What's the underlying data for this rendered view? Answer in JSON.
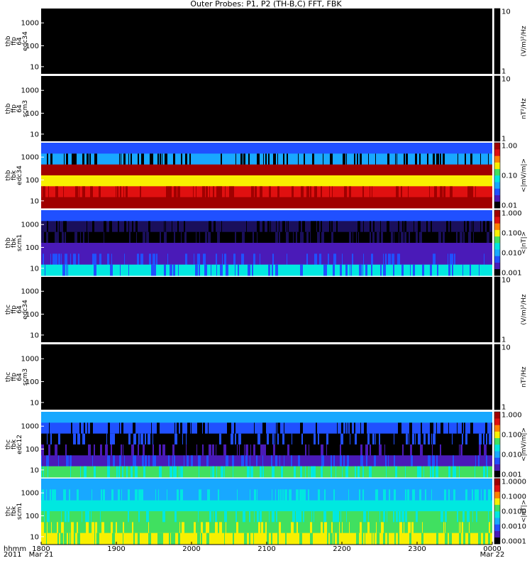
{
  "title": "Outer Probes: P1, P2 (TH-B,C) FFT, FBK",
  "colors": {
    "black": "#000000",
    "navy": "#1a0f5c",
    "purple": "#4a1ab8",
    "blue": "#2050ff",
    "lightblue": "#18a8ff",
    "cyan": "#00e8e0",
    "green": "#40e060",
    "yellow": "#f8f000",
    "orange": "#ff8000",
    "red": "#e01010",
    "darkred": "#a00000"
  },
  "chart_data": [
    {
      "type": "heatmap",
      "panel": "thb-ffp64-edc34",
      "ylabel": [
        "thb",
        "ffp",
        "64",
        "edc34"
      ],
      "yticks": [
        "1000",
        "100",
        "10"
      ],
      "cbar_label": "(V/m)²/Hz",
      "cbar_ticks": [
        "10",
        "1"
      ],
      "bands": []
    },
    {
      "type": "heatmap",
      "panel": "thb-ffp64-scm3",
      "ylabel": [
        "thb",
        "ffp",
        "64",
        "scm3"
      ],
      "yticks": [
        "1000",
        "100",
        "10"
      ],
      "cbar_label": "nT²/Hz",
      "cbar_ticks": [
        "10",
        "1"
      ],
      "bands": []
    },
    {
      "type": "heatmap",
      "panel": "thb-fbk-edc34",
      "ylabel": [
        "thb",
        "fbk",
        "edc34"
      ],
      "yticks": [
        "1000",
        "100",
        "10"
      ],
      "cbar_label": "<|mV/m|>",
      "cbar_ticks": [
        "1.00",
        "0.10",
        "0.01"
      ],
      "bands": [
        [
          "blue",
          "none"
        ],
        [
          "lightblue",
          "black"
        ],
        [
          "darkred",
          "none"
        ],
        [
          "yellow",
          "none"
        ],
        [
          "red",
          "darkred"
        ],
        [
          "darkred",
          "none"
        ]
      ]
    },
    {
      "type": "heatmap",
      "panel": "thb-fbk-scm1",
      "ylabel": [
        "thb",
        "fbk",
        "scm1"
      ],
      "yticks": [
        "1000",
        "100",
        "10"
      ],
      "cbar_label": "<|nT|>",
      "cbar_ticks": [
        "1.000",
        "0.100",
        "0.010",
        "0.001"
      ],
      "bands": [
        [
          "blue",
          "none"
        ],
        [
          "navy",
          "black"
        ],
        [
          "black",
          "navy"
        ],
        [
          "purple",
          "none"
        ],
        [
          "purple",
          "blue"
        ],
        [
          "cyan",
          "blue"
        ]
      ]
    },
    {
      "type": "heatmap",
      "panel": "thc-ffp64-edc34",
      "ylabel": [
        "thc",
        "ffp",
        "64",
        "edc34"
      ],
      "yticks": [
        "1000",
        "100",
        "10"
      ],
      "cbar_label": "(V/m)²/Hz",
      "cbar_ticks": [
        "10",
        "1"
      ],
      "bands": []
    },
    {
      "type": "heatmap",
      "panel": "thc-ffp64-scm3",
      "ylabel": [
        "thc",
        "ffp",
        "64",
        "scm3"
      ],
      "yticks": [
        "1000",
        "100",
        "10"
      ],
      "cbar_label": "nT²/Hz",
      "cbar_ticks": [
        "10",
        "1"
      ],
      "bands": []
    },
    {
      "type": "heatmap",
      "panel": "thc-fbk-edc12",
      "ylabel": [
        "thc",
        "fbk",
        "edc12"
      ],
      "yticks": [
        "1000",
        "100",
        "10"
      ],
      "cbar_label": "<|mV/m|>",
      "cbar_ticks": [
        "1.000",
        "0.100",
        "0.010",
        "0.001"
      ],
      "bands": [
        [
          "lightblue",
          "none"
        ],
        [
          "blue",
          "black"
        ],
        [
          "black",
          "blue"
        ],
        [
          "black",
          "purple"
        ],
        [
          "purple",
          "blue"
        ],
        [
          "green",
          "cyan"
        ]
      ]
    },
    {
      "type": "heatmap",
      "panel": "thc-fbk-scm1",
      "ylabel": [
        "thc",
        "fbk",
        "scm1"
      ],
      "yticks": [
        "1000",
        "100",
        "10"
      ],
      "cbar_label": "<|nT|>",
      "cbar_ticks": [
        "1.0000",
        "0.1000",
        "0.0100",
        "0.0010",
        "0.0001"
      ],
      "bands": [
        [
          "lightblue",
          "none"
        ],
        [
          "lightblue",
          "cyan"
        ],
        [
          "cyan",
          "none"
        ],
        [
          "green",
          "cyan"
        ],
        [
          "green",
          "yellow"
        ],
        [
          "yellow",
          "green"
        ]
      ]
    }
  ],
  "xaxis": {
    "label_lines": [
      "hhmm",
      "2011"
    ],
    "ticks": [
      [
        "1800",
        "Mar 21"
      ],
      [
        "1900",
        ""
      ],
      [
        "2000",
        ""
      ],
      [
        "2100",
        ""
      ],
      [
        "2200",
        ""
      ],
      [
        "2300",
        ""
      ],
      [
        "0000",
        "Mar 22"
      ]
    ]
  },
  "colorbar_scale": [
    "black",
    "purple",
    "blue",
    "lightblue",
    "cyan",
    "green",
    "yellow",
    "orange",
    "red",
    "darkred"
  ]
}
